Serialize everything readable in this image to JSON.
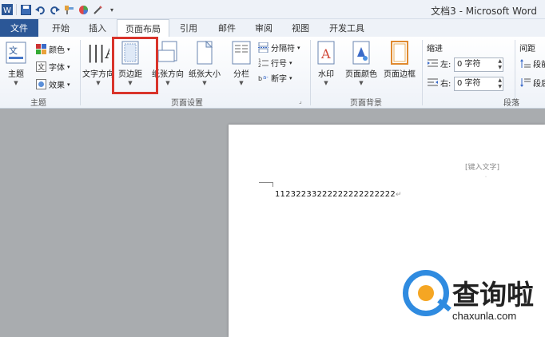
{
  "window": {
    "title": "文档3 - Microsoft Word"
  },
  "tabs": [
    {
      "label": "文件"
    },
    {
      "label": "开始"
    },
    {
      "label": "插入"
    },
    {
      "label": "页面布局"
    },
    {
      "label": "引用"
    },
    {
      "label": "邮件"
    },
    {
      "label": "审阅"
    },
    {
      "label": "视图"
    },
    {
      "label": "开发工具"
    }
  ],
  "ribbon": {
    "theme_group": {
      "label": "主题",
      "theme_button": "主题",
      "colors": "颜色",
      "fonts": "字体",
      "effects": "效果"
    },
    "page_setup_group": {
      "label": "页面设置",
      "text_direction": "文字方向",
      "margins": "页边距",
      "orientation": "纸张方向",
      "size": "纸张大小",
      "columns": "分栏",
      "breaks": "分隔符",
      "line_numbers": "行号",
      "hyphenation": "断字"
    },
    "page_background_group": {
      "label": "页面背景",
      "watermark": "水印",
      "page_color": "页面颜色",
      "page_borders": "页面边框"
    },
    "paragraph_group": {
      "label": "段落",
      "indent": "缩进",
      "spacing": "间距",
      "left_label": "左:",
      "right_label": "右:",
      "left_value": "0 字符",
      "right_value": "0 字符",
      "before_label": "段前",
      "after_label": "段后"
    }
  },
  "document": {
    "header_hint": "[键入文字]",
    "body_text": "11232233222222222222222"
  },
  "watermark": {
    "brand": "查询啦",
    "url": "chaxunla.com"
  },
  "colors": {
    "file_tab": "#2b5797",
    "highlight": "#d9342b",
    "logo_blue": "#2f8be0",
    "logo_orange": "#f5a623"
  }
}
